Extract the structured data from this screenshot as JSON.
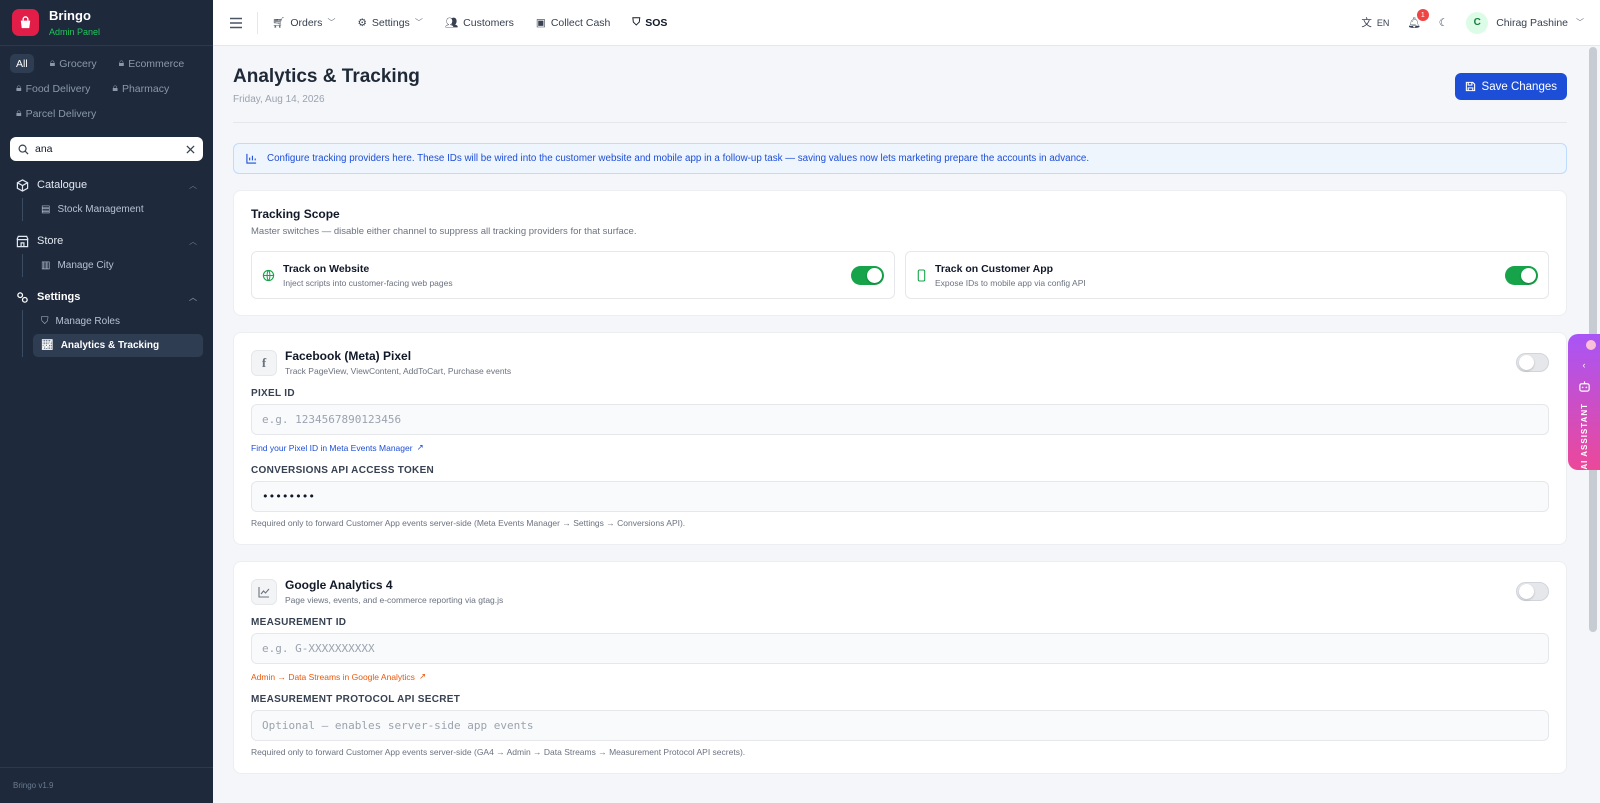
{
  "sidebar": {
    "brand": {
      "name": "Bringo",
      "subtitle": "Admin Panel"
    },
    "chips": [
      {
        "label": "All"
      },
      {
        "label": "Grocery"
      },
      {
        "label": "Ecommerce"
      },
      {
        "label": "Food Delivery"
      },
      {
        "label": "Pharmacy"
      },
      {
        "label": "Parcel Delivery"
      }
    ],
    "search": {
      "value": "ana"
    },
    "groups": [
      {
        "label": "Catalogue",
        "items": [
          {
            "label": "Stock Management"
          }
        ]
      },
      {
        "label": "Store",
        "items": [
          {
            "label": "Manage City"
          }
        ]
      },
      {
        "label": "Settings",
        "items": [
          {
            "label": "Manage Roles"
          },
          {
            "label": "Analytics & Tracking"
          }
        ]
      }
    ],
    "footer": "Bringo v1.9"
  },
  "topbar": {
    "nav": [
      {
        "label": "Orders"
      },
      {
        "label": "Settings"
      },
      {
        "label": "Customers"
      },
      {
        "label": "Collect Cash"
      },
      {
        "label": "SOS"
      }
    ],
    "language": "EN",
    "notification_count": "1",
    "user": {
      "initial": "C",
      "name": "Chirag Pashine"
    }
  },
  "page": {
    "title": "Analytics & Tracking",
    "date": "Friday, Aug 14, 2026",
    "save_label": "Save Changes",
    "info": "Configure tracking providers here. These IDs will be wired into the customer website and mobile app in a follow-up task — saving values now lets marketing prepare the accounts in advance."
  },
  "scope": {
    "title": "Tracking Scope",
    "subtitle": "Master switches — disable either channel to suppress all tracking providers for that surface.",
    "website": {
      "title": "Track on Website",
      "desc": "Inject scripts into customer-facing web pages",
      "enabled": true
    },
    "app": {
      "title": "Track on Customer App",
      "desc": "Expose IDs to mobile app via config API",
      "enabled": true
    }
  },
  "facebook": {
    "title": "Facebook (Meta) Pixel",
    "desc": "Track PageView, ViewContent, AddToCart, Purchase events",
    "enabled": false,
    "pixel_label": "PIXEL ID",
    "pixel_placeholder": "e.g. 1234567890123456",
    "pixel_link": "Find your Pixel ID in Meta Events Manager",
    "token_label": "CONVERSIONS API ACCESS TOKEN",
    "token_value": "••••••••",
    "token_hint": "Required only to forward Customer App events server-side (Meta Events Manager → Settings → Conversions API)."
  },
  "ga4": {
    "title": "Google Analytics 4",
    "desc": "Page views, events, and e-commerce reporting via gtag.js",
    "enabled": false,
    "measurement_label": "MEASUREMENT ID",
    "measurement_placeholder": "e.g. G-XXXXXXXXXX",
    "measurement_link": "Admin → Data Streams in Google Analytics",
    "secret_label": "MEASUREMENT PROTOCOL API SECRET",
    "secret_placeholder": "Optional — enables server-side app events",
    "secret_hint": "Required only to forward Customer App events server-side (GA4 → Admin → Data Streams → Measurement Protocol API secrets)."
  },
  "ai_assistant": {
    "label": "AI ASSISTANT"
  },
  "colors": {
    "sidebar": "#1e2a3b",
    "primary": "#1d4ed8",
    "success": "#16a34a",
    "brand": "#e11d48"
  }
}
